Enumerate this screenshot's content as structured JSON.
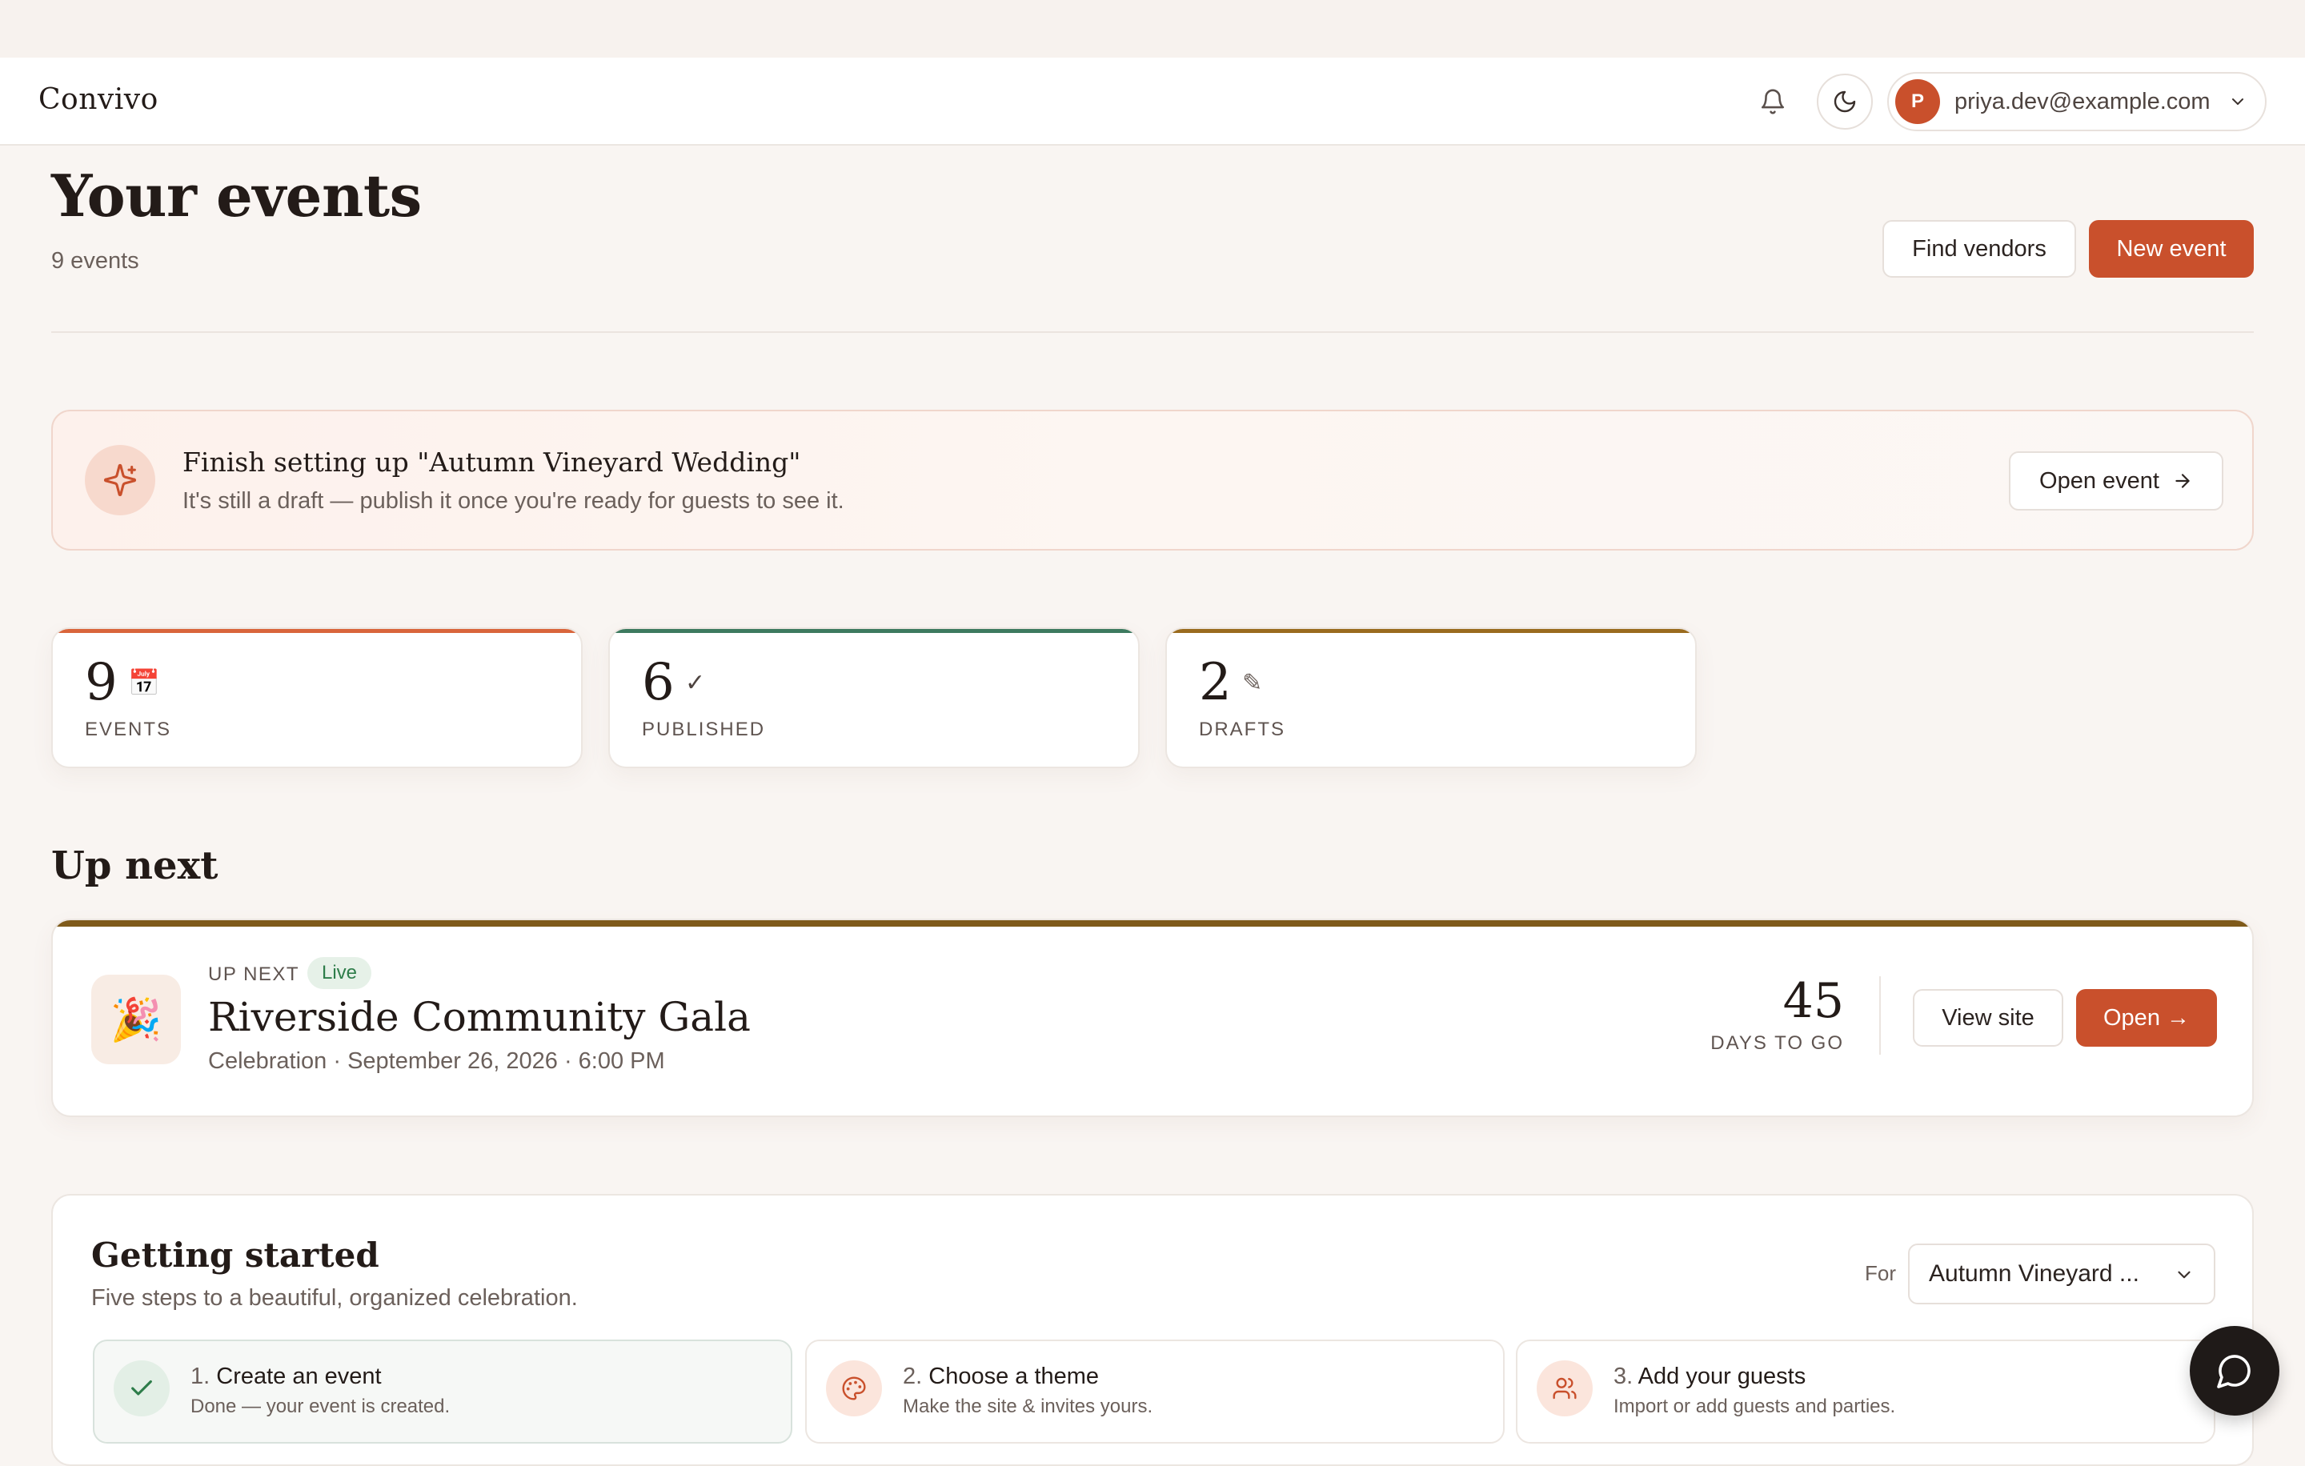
{
  "app": {
    "brand": "Convivo"
  },
  "topbar": {
    "icons": [
      "bell-icon",
      "moon-icon"
    ],
    "user": {
      "initial": "P",
      "email": "priya.dev@example.com"
    }
  },
  "header": {
    "title": "Your events",
    "count_text": "9 events",
    "find_vendors_label": "Find vendors",
    "new_event_label": "New event"
  },
  "banner": {
    "title": "Finish setting up \"Autumn Vineyard Wedding\"",
    "subtitle": "It's still a draft — publish it once you're ready for guests to see it.",
    "button_label": "Open event"
  },
  "stats": [
    {
      "value": "9",
      "glyph": "📅",
      "label": "EVENTS",
      "color": "#d9653b"
    },
    {
      "value": "6",
      "glyph": "✓",
      "label": "PUBLISHED",
      "color": "#3d7a5f"
    },
    {
      "value": "2",
      "glyph": "✎",
      "label": "DRAFTS",
      "color": "#9a6b1e"
    }
  ],
  "up_next": {
    "section_title": "Up next",
    "kicker": "UP NEXT",
    "badge": "Live",
    "emoji": "🎉",
    "name": "Riverside Community Gala",
    "meta": "Celebration · September 26, 2026 · 6:00 PM",
    "days_value": "45",
    "days_label": "DAYS TO GO",
    "view_site_label": "View site",
    "open_label": "Open →"
  },
  "getting_started": {
    "title": "Getting started",
    "subtitle": "Five steps to a beautiful, organized celebration.",
    "for_label": "For",
    "for_value": "Autumn Vineyard ...",
    "steps": [
      {
        "number": "1.",
        "title": "Create an event",
        "subtitle": "Done — your event is created.",
        "icon": "check-icon",
        "done": true
      },
      {
        "number": "2.",
        "title": "Choose a theme",
        "subtitle": "Make the site & invites yours.",
        "icon": "palette-icon",
        "done": false
      },
      {
        "number": "3.",
        "title": "Add your guests",
        "subtitle": "Import or add guests and parties.",
        "icon": "users-icon",
        "done": false
      }
    ]
  },
  "colors": {
    "accent": "#c9502c",
    "live_bg": "#e6f1e8",
    "live_text": "#2e7d4a"
  }
}
